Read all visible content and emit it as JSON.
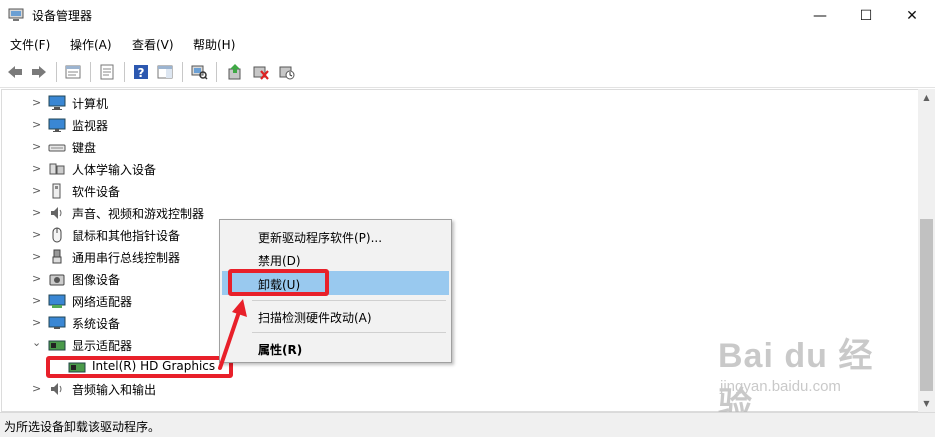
{
  "window": {
    "title": "设备管理器",
    "minimize": "—",
    "maximize": "☐",
    "close": "✕"
  },
  "menu": [
    "文件(F)",
    "操作(A)",
    "查看(V)",
    "帮助(H)"
  ],
  "toolbar_icons": [
    "back-arrow-icon",
    "forward-arrow-icon",
    "show-hide-tree-icon",
    "properties-icon",
    "help-icon",
    "action-pane-icon",
    "scan-hardware-icon",
    "update-driver-icon",
    "uninstall-device-icon",
    "disable-device-icon"
  ],
  "tree": {
    "items": [
      {
        "label": "计算机",
        "expanded": false,
        "icon": "computer-icon"
      },
      {
        "label": "监视器",
        "expanded": false,
        "icon": "monitor-icon"
      },
      {
        "label": "键盘",
        "expanded": false,
        "icon": "keyboard-icon"
      },
      {
        "label": "人体学输入设备",
        "expanded": false,
        "icon": "hid-icon"
      },
      {
        "label": "软件设备",
        "expanded": false,
        "icon": "software-device-icon"
      },
      {
        "label": "声音、视频和游戏控制器",
        "expanded": false,
        "icon": "speaker-icon"
      },
      {
        "label": "鼠标和其他指针设备",
        "expanded": false,
        "icon": "mouse-icon"
      },
      {
        "label": "通用串行总线控制器",
        "expanded": false,
        "icon": "usb-icon"
      },
      {
        "label": "图像设备",
        "expanded": false,
        "icon": "camera-icon"
      },
      {
        "label": "网络适配器",
        "expanded": false,
        "icon": "network-adapter-icon"
      },
      {
        "label": "系统设备",
        "expanded": false,
        "icon": "system-device-icon"
      },
      {
        "label": "显示适配器",
        "expanded": true,
        "icon": "display-adapter-icon"
      },
      {
        "label": "Intel(R) HD Graphics",
        "child": true,
        "selected": true,
        "icon": "display-adapter-icon"
      },
      {
        "label": "音频输入和输出",
        "expanded": false,
        "icon": "speaker-icon"
      }
    ]
  },
  "context_menu": {
    "items": [
      {
        "label": "更新驱动程序软件(P)...",
        "bold": false
      },
      {
        "label": "禁用(D)",
        "bold": false
      },
      {
        "label": "卸载(U)",
        "bold": false,
        "highlighted": true
      },
      {
        "label": "扫描检测硬件改动(A)",
        "bold": false
      },
      {
        "label": "属性(R)",
        "bold": true
      }
    ]
  },
  "status": "为所选设备卸载该驱动程序。",
  "watermark": {
    "main": "Bai du 经验",
    "sub": "jingyan.baidu.com"
  },
  "colors": {
    "highlight": "#99c9ef",
    "annotation_red": "#e8202a"
  }
}
